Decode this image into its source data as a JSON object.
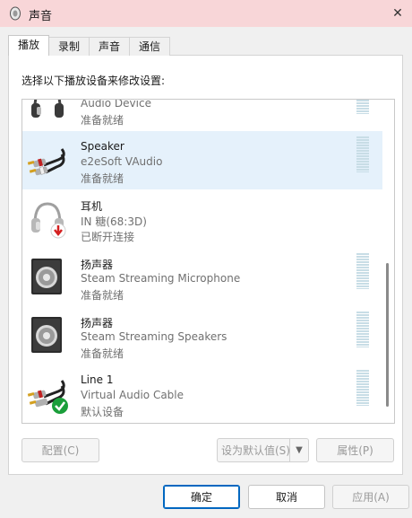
{
  "window": {
    "title": "声音",
    "close_glyph": "✕"
  },
  "tabs": [
    {
      "label": "播放",
      "active": true
    },
    {
      "label": "录制",
      "active": false
    },
    {
      "label": "声音",
      "active": false
    },
    {
      "label": "通信",
      "active": false
    }
  ],
  "instruction": "选择以下播放设备来修改设置:",
  "devices": [
    {
      "name": "",
      "description": "Audio Device",
      "status": "准备就绪",
      "icon": "headphones-icon",
      "selected": false
    },
    {
      "name": "Speaker",
      "description": "e2eSoft VAudio",
      "status": "准备就绪",
      "icon": "rca-cable-icon",
      "selected": true
    },
    {
      "name": "耳机",
      "description": "IN 糖(68:3D)",
      "status": "已断开连接",
      "icon": "headphones-disconnected-icon",
      "selected": false
    },
    {
      "name": "扬声器",
      "description": "Steam Streaming Microphone",
      "status": "准备就绪",
      "icon": "speaker-icon",
      "selected": false
    },
    {
      "name": "扬声器",
      "description": "Steam Streaming Speakers",
      "status": "准备就绪",
      "icon": "speaker-icon",
      "selected": false
    },
    {
      "name": "Line 1",
      "description": "Virtual Audio Cable",
      "status": "默认设备",
      "icon": "rca-cable-default-icon",
      "selected": false
    }
  ],
  "buttons": {
    "configure": "配置(C)",
    "set_default": "设为默认值(S)",
    "properties": "属性(P)",
    "ok": "确定",
    "cancel": "取消",
    "apply": "应用(A)"
  },
  "colors": {
    "titlebar": "#f8d6d8",
    "selection": "#e5f1fb",
    "accent": "#0067c0",
    "default_check": "#1a9e3a",
    "disconnect_arrow": "#d42020"
  }
}
